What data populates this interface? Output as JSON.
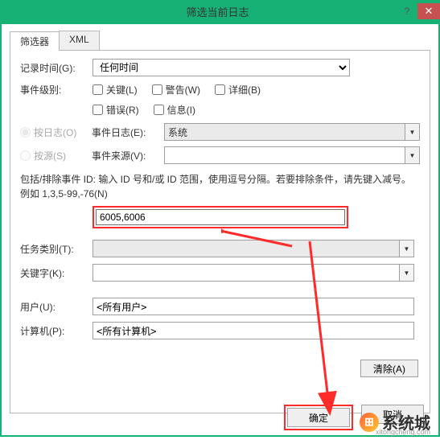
{
  "window": {
    "title": "筛选当前日志",
    "help": "?",
    "close": "✕"
  },
  "tabs": {
    "filter": "筛选器",
    "xml": "XML"
  },
  "labels": {
    "log_time": "记录时间(G):",
    "event_level": "事件级别:",
    "by_log": "按日志(O)",
    "by_source": "按源(S)",
    "event_logs": "事件日志(E):",
    "event_sources": "事件来源(V):",
    "task_category": "任务类别(T):",
    "keywords": "关键字(K):",
    "user": "用户(U):",
    "computer": "计算机(P):"
  },
  "values": {
    "log_time": "任何时间",
    "event_logs": "系统",
    "event_sources": "",
    "id_input": "6005,6006",
    "task_category": "",
    "keywords": "",
    "user": "<所有用户>",
    "computer": "<所有计算机>"
  },
  "checkboxes": {
    "critical": "关键(L)",
    "warning": "警告(W)",
    "verbose": "详细(B)",
    "error": "错误(R)",
    "information": "信息(I)"
  },
  "help_text": "包括/排除事件 ID: 输入 ID 号和/或 ID 范围，使用逗号分隔。若要排除条件，请先键入减号。例如 1,3,5-99,-76(N)",
  "buttons": {
    "clear": "清除(A)",
    "ok": "确定",
    "cancel": "取消"
  },
  "watermark": {
    "brand": "系统城",
    "sub": "xitongcheng.com",
    "logo": "⊞"
  }
}
